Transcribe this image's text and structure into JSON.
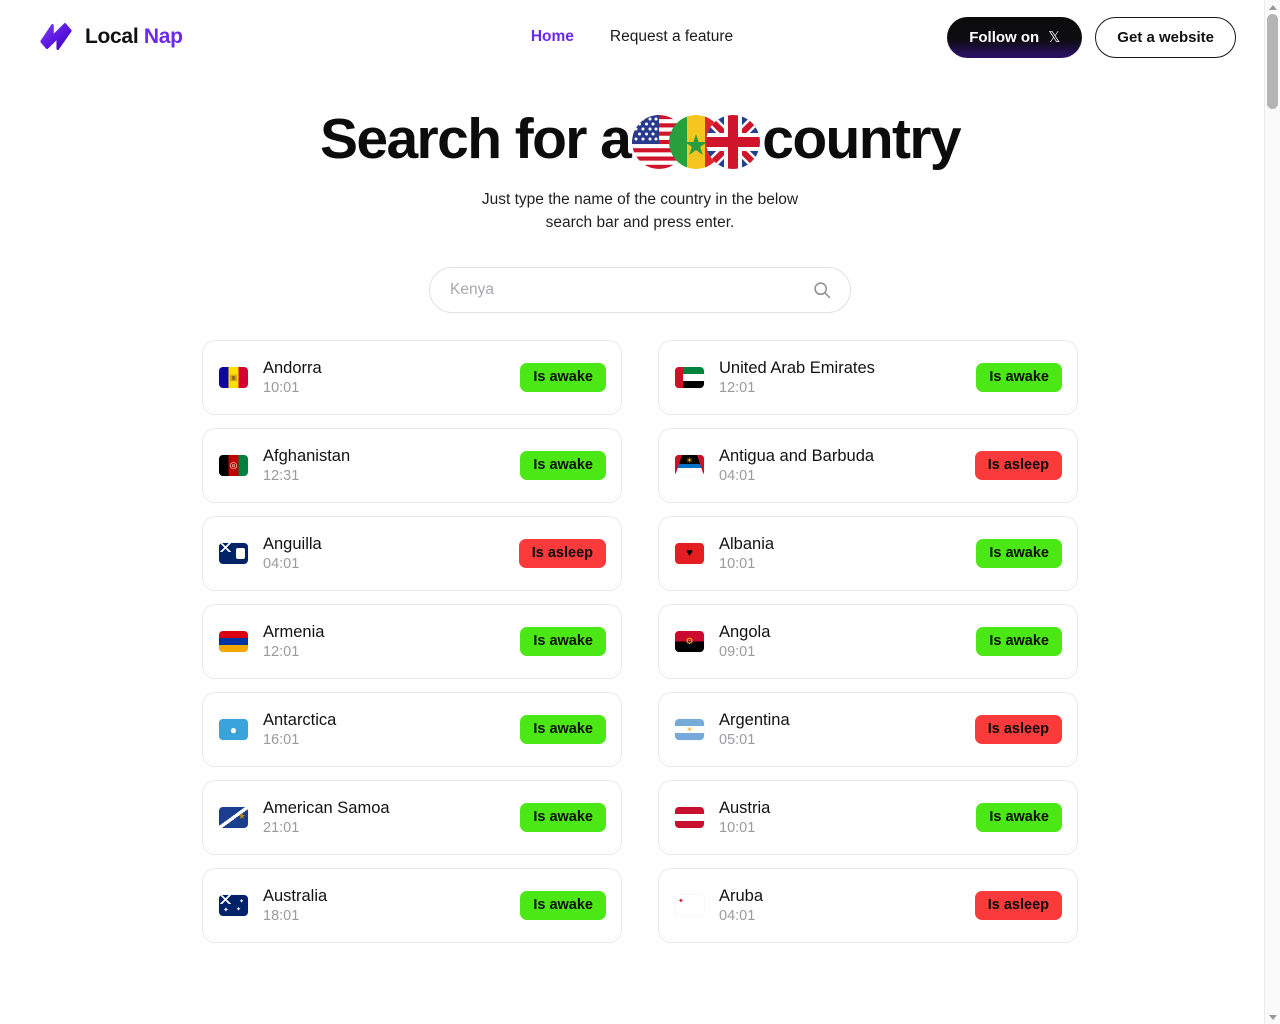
{
  "brand": {
    "name_first": "Local",
    "name_second": "Nap",
    "logo_icon": "zigzag-logo-icon",
    "accent_color": "#6d28f0"
  },
  "nav": {
    "items": [
      {
        "label": "Home",
        "active": true
      },
      {
        "label": "Request a feature",
        "active": false
      }
    ]
  },
  "header_actions": {
    "follow_label": "Follow on",
    "follow_icon": "x-twitter-icon",
    "website_label": "Get a website"
  },
  "hero": {
    "title_before": "Search for a",
    "title_after": "country",
    "flag_circles": [
      "united-states-flag",
      "senegal-flag",
      "united-kingdom-flag"
    ],
    "subtitle_line1": "Just type the name of the country in the below",
    "subtitle_line2": "search bar and press enter."
  },
  "search": {
    "value": "",
    "placeholder": "Kenya",
    "icon": "search-icon"
  },
  "status_colors": {
    "awake": "#4ce815",
    "asleep": "#fb3b3b"
  },
  "countries": [
    {
      "name": "Andorra",
      "time": "10:01",
      "status": "Is awake",
      "state": "awake",
      "flag": "andorra-flag"
    },
    {
      "name": "United Arab Emirates",
      "time": "12:01",
      "status": "Is awake",
      "state": "awake",
      "flag": "uae-flag"
    },
    {
      "name": "Afghanistan",
      "time": "12:31",
      "status": "Is awake",
      "state": "awake",
      "flag": "afghanistan-flag"
    },
    {
      "name": "Antigua and Barbuda",
      "time": "04:01",
      "status": "Is asleep",
      "state": "asleep",
      "flag": "antigua-and-barbuda-flag"
    },
    {
      "name": "Anguilla",
      "time": "04:01",
      "status": "Is asleep",
      "state": "asleep",
      "flag": "anguilla-flag"
    },
    {
      "name": "Albania",
      "time": "10:01",
      "status": "Is awake",
      "state": "awake",
      "flag": "albania-flag"
    },
    {
      "name": "Armenia",
      "time": "12:01",
      "status": "Is awake",
      "state": "awake",
      "flag": "armenia-flag"
    },
    {
      "name": "Angola",
      "time": "09:01",
      "status": "Is awake",
      "state": "awake",
      "flag": "angola-flag"
    },
    {
      "name": "Antarctica",
      "time": "16:01",
      "status": "Is awake",
      "state": "awake",
      "flag": "antarctica-flag"
    },
    {
      "name": "Argentina",
      "time": "05:01",
      "status": "Is asleep",
      "state": "asleep",
      "flag": "argentina-flag"
    },
    {
      "name": "American Samoa",
      "time": "21:01",
      "status": "Is awake",
      "state": "awake",
      "flag": "american-samoa-flag"
    },
    {
      "name": "Austria",
      "time": "10:01",
      "status": "Is awake",
      "state": "awake",
      "flag": "austria-flag"
    },
    {
      "name": "Australia",
      "time": "18:01",
      "status": "Is awake",
      "state": "awake",
      "flag": "australia-flag"
    },
    {
      "name": "Aruba",
      "time": "04:01",
      "status": "Is asleep",
      "state": "asleep",
      "flag": "aruba-flag"
    }
  ]
}
